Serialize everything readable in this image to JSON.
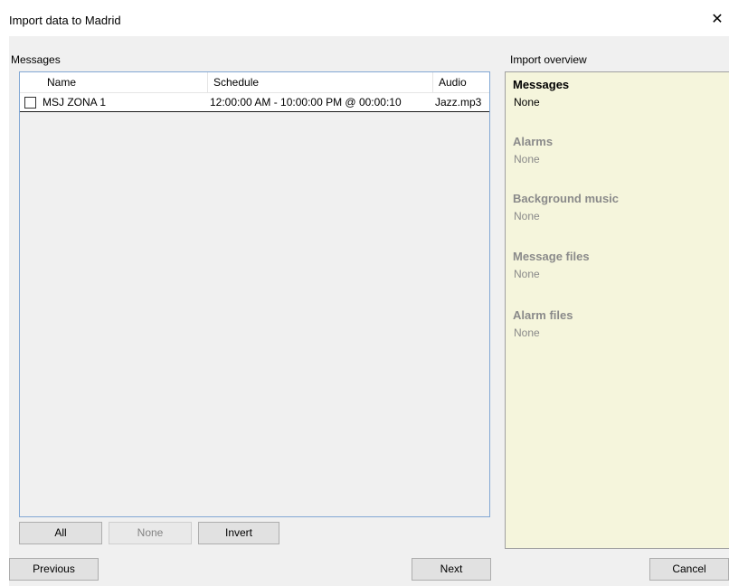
{
  "window": {
    "title": "Import data to Madrid",
    "close_symbol": "✕"
  },
  "messages_panel": {
    "label": "Messages",
    "columns": [
      "Name",
      "Schedule",
      "Audio"
    ],
    "rows": [
      {
        "checked": false,
        "name": "MSJ ZONA 1",
        "schedule": "12:00:00 AM - 10:00:00 PM @ 00:00:10",
        "audio": "Jazz.mp3"
      }
    ],
    "buttons": {
      "all": "All",
      "none": "None",
      "invert": "Invert"
    }
  },
  "overview": {
    "label": "Import overview",
    "sections": [
      {
        "title": "Messages",
        "value": "None",
        "active": true
      },
      {
        "title": "Alarms",
        "value": "None",
        "active": false
      },
      {
        "title": "Background music",
        "value": "None",
        "active": false
      },
      {
        "title": "Message files",
        "value": "None",
        "active": false
      },
      {
        "title": "Alarm files",
        "value": "None",
        "active": false
      }
    ]
  },
  "footer": {
    "previous": "Previous",
    "next": "Next",
    "cancel": "Cancel"
  }
}
